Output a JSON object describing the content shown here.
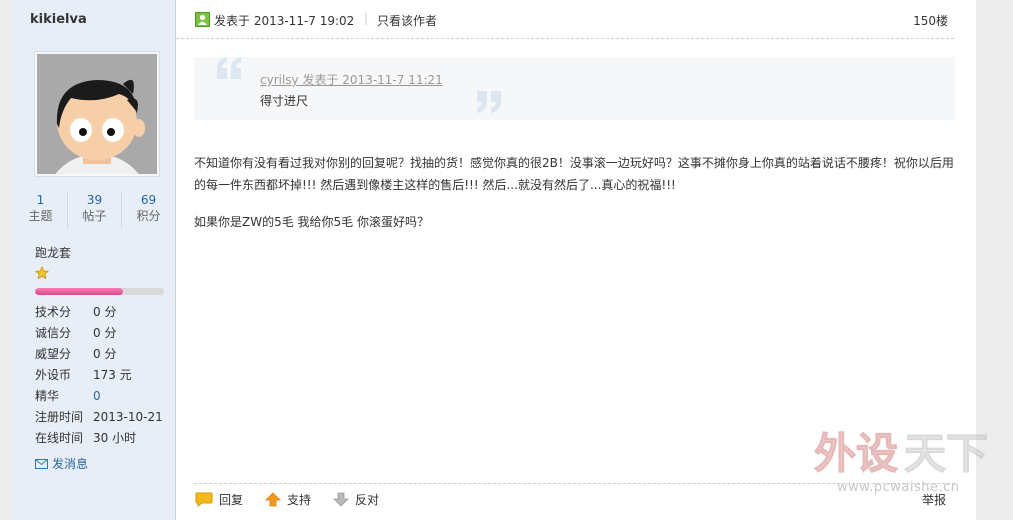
{
  "user": {
    "name": "kikielva",
    "stats": [
      {
        "value": "1",
        "label": "主题"
      },
      {
        "value": "39",
        "label": "帖子"
      },
      {
        "value": "69",
        "label": "积分"
      }
    ],
    "rank": "跑龙套",
    "rank_progress": 0.68,
    "profile": [
      {
        "key": "技术分",
        "value": "0 分"
      },
      {
        "key": "诚信分",
        "value": "0 分"
      },
      {
        "key": "威望分",
        "value": "0 分"
      },
      {
        "key": "外设币",
        "value": "173 元"
      },
      {
        "key": "精华",
        "value": "0"
      },
      {
        "key": "注册时间",
        "value": "2013-10-21"
      },
      {
        "key": "在线时间",
        "value": "30 小时"
      }
    ],
    "send_message": "发消息"
  },
  "post": {
    "posted": "发表于 2013-11-7 19:02",
    "only_author": "只看该作者",
    "floor": "150楼",
    "quote": {
      "author_line": "cyrilsy 发表于 2013-11-7 11:21",
      "text": "得寸进尺"
    },
    "paragraphs": [
      "不知道你有没有看过我对你别的回复呢？找抽的货！感觉你真的很2B！没事滚一边玩好吗？这事不摊你身上你真的站着说话不腰疼！祝你以后用的每一件东西都坏掉!!! 然后遇到像楼主这样的售后!!! 然后...就没有然后了...真心的祝福!!!",
      "如果你是ZW的5毛 我给你5毛 你滚蛋好吗？"
    ],
    "actions": {
      "reply": "回复",
      "support": "支持",
      "oppose": "反对",
      "report": "举报"
    }
  },
  "watermark": {
    "logo_text": "外设天下",
    "url": "www.pcwaishe.cn"
  },
  "colors": {
    "sidebar_bg": "#e8eef7",
    "link": "#2366a8",
    "rank_bar": "#e0468f"
  }
}
